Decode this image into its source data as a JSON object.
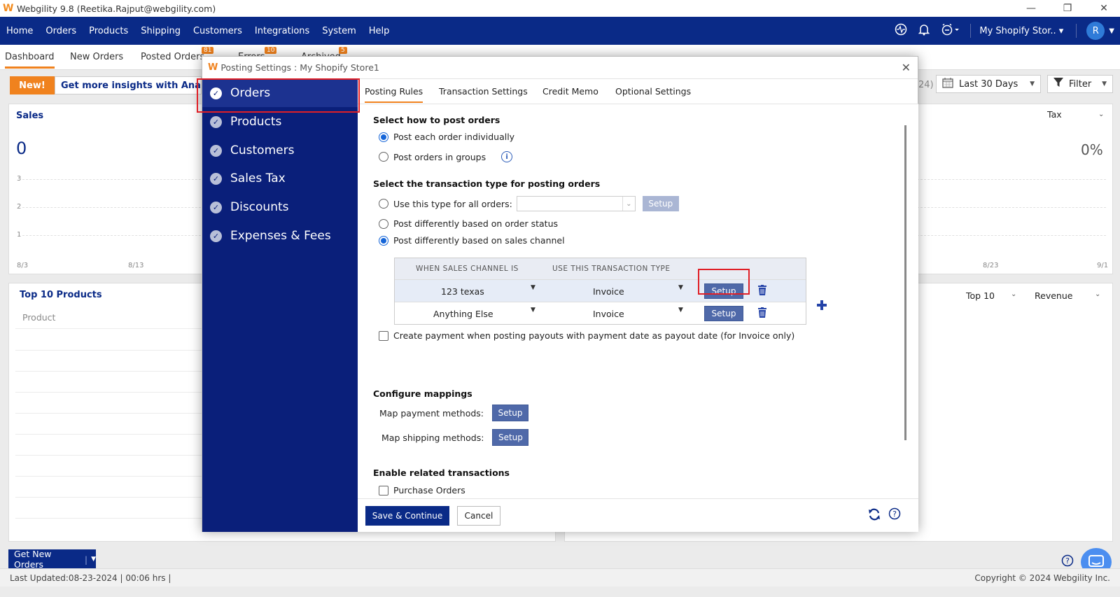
{
  "window": {
    "title": "Webgility 9.8 (Reetika.Rajput@webgility.com)",
    "controls": [
      "—",
      "❐",
      "✕"
    ]
  },
  "mainnav": {
    "items": [
      "Home",
      "Orders",
      "Products",
      "Shipping",
      "Customers",
      "Integrations",
      "System",
      "Help"
    ],
    "store": "My Shopify Stor..",
    "avatar_letter": "R"
  },
  "subtabs": {
    "items": [
      "Dashboard",
      "New Orders",
      "Posted Orders",
      "Errors",
      "Archived"
    ],
    "badges": {
      "posted": "81",
      "errors": "10",
      "archived": "5"
    }
  },
  "dashboard": {
    "promo_new": "New!",
    "promo_text": "Get more insights with Analytics",
    "date_range_fragment": "24)",
    "date_range": "Last 30 Days",
    "filter": "Filter",
    "sales_title": "Sales",
    "sales_value": "0",
    "tax_label": "Tax",
    "tax_value": "0%",
    "y_ticks": [
      "3",
      "2",
      "1"
    ],
    "x_ticks_left": [
      "8/3",
      "8/13"
    ],
    "x_ticks_right": [
      "8/23",
      "9/1"
    ],
    "top_products_title": "Top 10 Products",
    "product_col": "Product",
    "top_select": "Top 10",
    "revenue_select": "Revenue",
    "get_new_orders": "Get New Orders",
    "last_updated": "Last Updated:08-23-2024 | 00:06 hrs |",
    "copyright": "Copyright © 2024 Webgility Inc."
  },
  "modal": {
    "title": "Posting Settings : My Shopify Store1",
    "sidebar": [
      "Orders",
      "Products",
      "Customers",
      "Sales Tax",
      "Discounts",
      "Expenses & Fees"
    ],
    "tabs": [
      "Posting Rules",
      "Transaction Settings",
      "Credit Memo",
      "Optional Settings"
    ],
    "section_how": "Select how to post orders",
    "opt_individual": "Post each order individually",
    "opt_groups": "Post orders in groups",
    "section_type": "Select the transaction type for posting orders",
    "opt_all_type": "Use this type for all orders:",
    "opt_status": "Post differently based on order status",
    "opt_channel": "Post differently based on sales channel",
    "setup_label": "Setup",
    "table": {
      "headers": [
        "WHEN SALES CHANNEL IS",
        "USE THIS TRANSACTION TYPE"
      ],
      "rows": [
        {
          "channel": "123 texas",
          "type": "Invoice"
        },
        {
          "channel": "Anything Else",
          "type": "Invoice"
        }
      ]
    },
    "payout_checkbox": "Create payment when posting payouts with payment date as payout date (for Invoice only)",
    "section_mappings": "Configure mappings",
    "map_payment": "Map payment methods:",
    "map_shipping": "Map shipping methods:",
    "section_related": "Enable related transactions",
    "purchase_orders": "Purchase Orders",
    "save_continue": "Save & Continue",
    "cancel": "Cancel"
  },
  "colors": {
    "nav_bg": "#0a2a87",
    "sidebar_bg": "#0a1f7a",
    "accent": "#f0821e",
    "button": "#4f69a9",
    "highlight": "#e01f26"
  }
}
